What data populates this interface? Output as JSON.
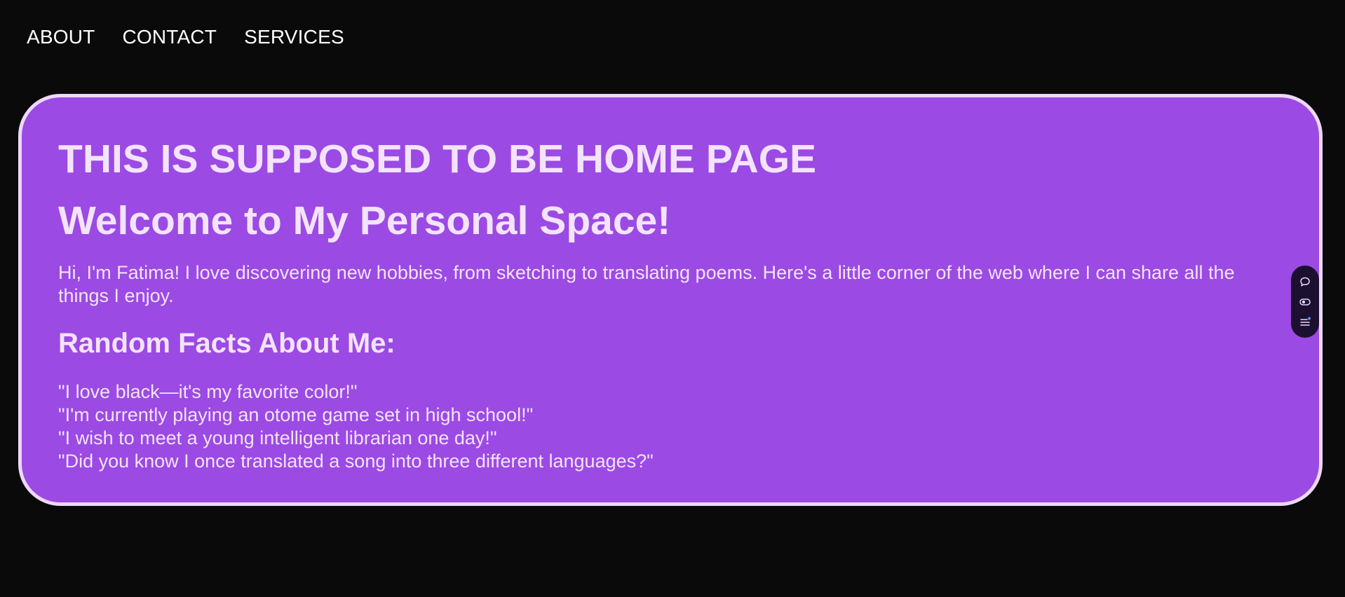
{
  "nav": {
    "about": "ABOUT",
    "contact": "CONTACT",
    "services": "SERVICES"
  },
  "main": {
    "home_title": "THIS IS SUPPOSED TO BE HOME PAGE",
    "welcome": "Welcome to My Personal Space!",
    "intro": "Hi, I'm Fatima! I love discovering new hobbies, from sketching to translating poems. Here's a little corner of the web where I can share all the things I enjoy.",
    "facts_title": "Random Facts About Me:",
    "facts": [
      "\"I love black—it's my favorite color!\"",
      "\"I'm currently playing an otome game set in high school!\"",
      "\"I wish to meet a young intelligent librarian one day!\"",
      "\"Did you know I once translated a song into three different languages?\""
    ]
  },
  "side_widget": {
    "icons": [
      "comment-icon",
      "eye-icon",
      "menu-icon"
    ]
  },
  "colors": {
    "background": "#0a0a0a",
    "card": "#9b4ae3",
    "card_border": "#ecd8fb",
    "card_text": "#f3e3fd",
    "nav_text": "#ffffff",
    "widget": "#1c1030"
  }
}
